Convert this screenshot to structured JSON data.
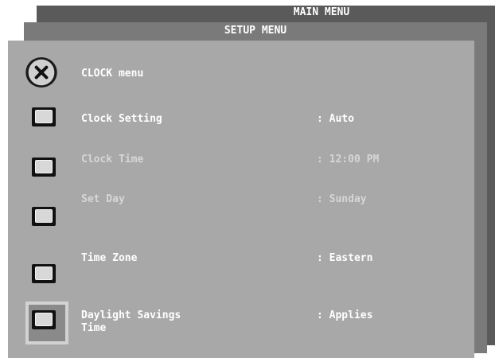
{
  "main_menu": {
    "title": "MAIN MENU"
  },
  "setup_menu": {
    "title": "SETUP MENU"
  },
  "clock_menu": {
    "title": "CLOCK menu",
    "items": [
      {
        "label": "Clock Setting",
        "value": ": Auto",
        "enabled": true
      },
      {
        "label": "Clock Time",
        "value": ": 12:00 PM",
        "enabled": false
      },
      {
        "label": "Set Day",
        "value": ": Sunday",
        "enabled": false
      },
      {
        "label": "Time Zone",
        "value": ": Eastern",
        "enabled": true
      },
      {
        "label": "Daylight Savings\nTime",
        "value": ": Applies",
        "enabled": true,
        "selected": true
      }
    ]
  },
  "icons": {
    "menu_icon": "clock-icon",
    "item_button": "square-button"
  }
}
